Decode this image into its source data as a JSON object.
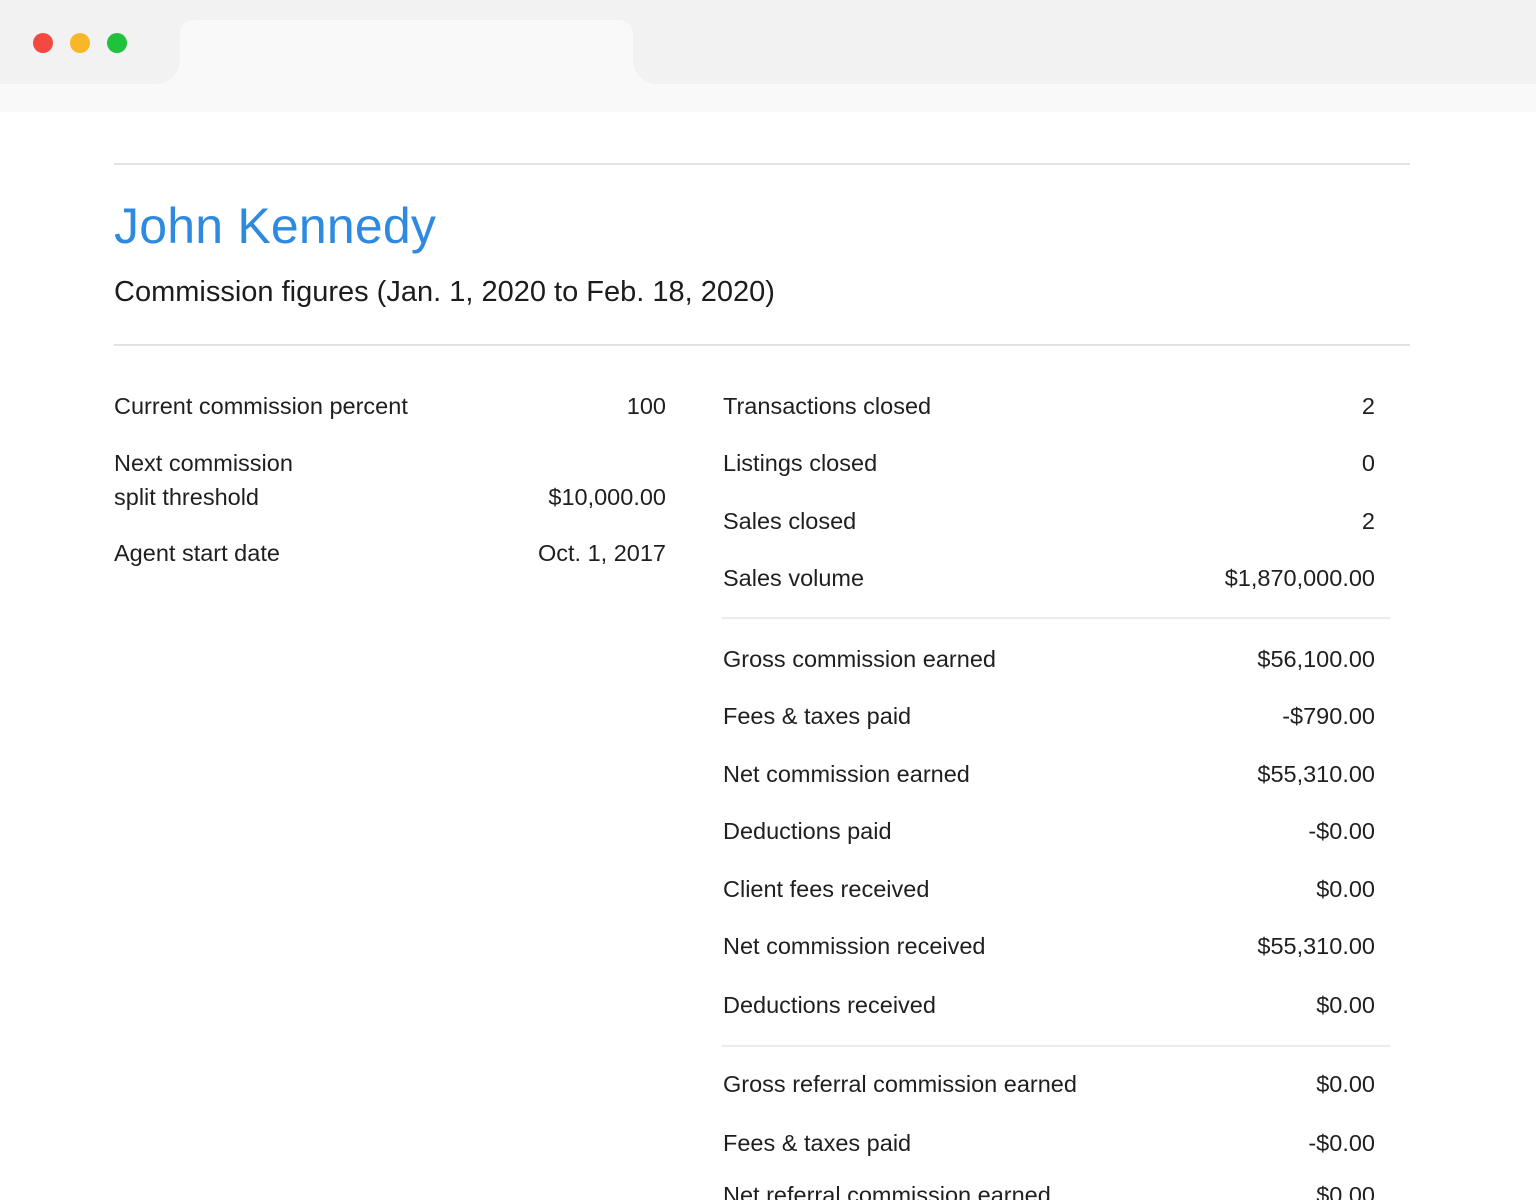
{
  "window": {
    "controls": [
      "close",
      "minimize",
      "maximize"
    ],
    "colors": {
      "close": "#f4493f",
      "minimize": "#f8b726",
      "maximize": "#1fc23b"
    }
  },
  "header": {
    "agent_name": "John Kennedy",
    "subtitle": "Commission figures (Jan. 1, 2020 to Feb. 18, 2020)",
    "accent_color": "#2e8ae0"
  },
  "left_stats": {
    "current_commission_percent": {
      "label": "Current commission percent",
      "value": "100"
    },
    "next_split_threshold": {
      "label_line1": "Next commission",
      "label_line2": "split threshold",
      "value": "$10,000.00"
    },
    "agent_start_date": {
      "label": "Agent start date",
      "value": "Oct. 1, 2017"
    }
  },
  "right_stats": {
    "transactions": [
      {
        "label": "Transactions closed",
        "value": "2"
      },
      {
        "label": "Listings closed",
        "value": "0"
      },
      {
        "label": "Sales closed",
        "value": "2"
      },
      {
        "label": "Sales volume",
        "value": "$1,870,000.00"
      }
    ],
    "commissions": [
      {
        "label": "Gross commission earned",
        "value": "$56,100.00"
      },
      {
        "label": "Fees & taxes paid",
        "value": "-$790.00"
      },
      {
        "label": "Net commission earned",
        "value": "$55,310.00"
      },
      {
        "label": "Deductions paid",
        "value": "-$0.00"
      },
      {
        "label": "Client fees received",
        "value": "$0.00"
      },
      {
        "label": "Net commission received",
        "value": "$55,310.00"
      },
      {
        "label": "Deductions received",
        "value": "$0.00"
      }
    ],
    "referrals": [
      {
        "label": "Gross referral commission earned",
        "value": "$0.00"
      },
      {
        "label": "Fees & taxes paid",
        "value": "-$0.00"
      },
      {
        "label": "Net referral commission earned",
        "value": "$0.00"
      }
    ]
  }
}
